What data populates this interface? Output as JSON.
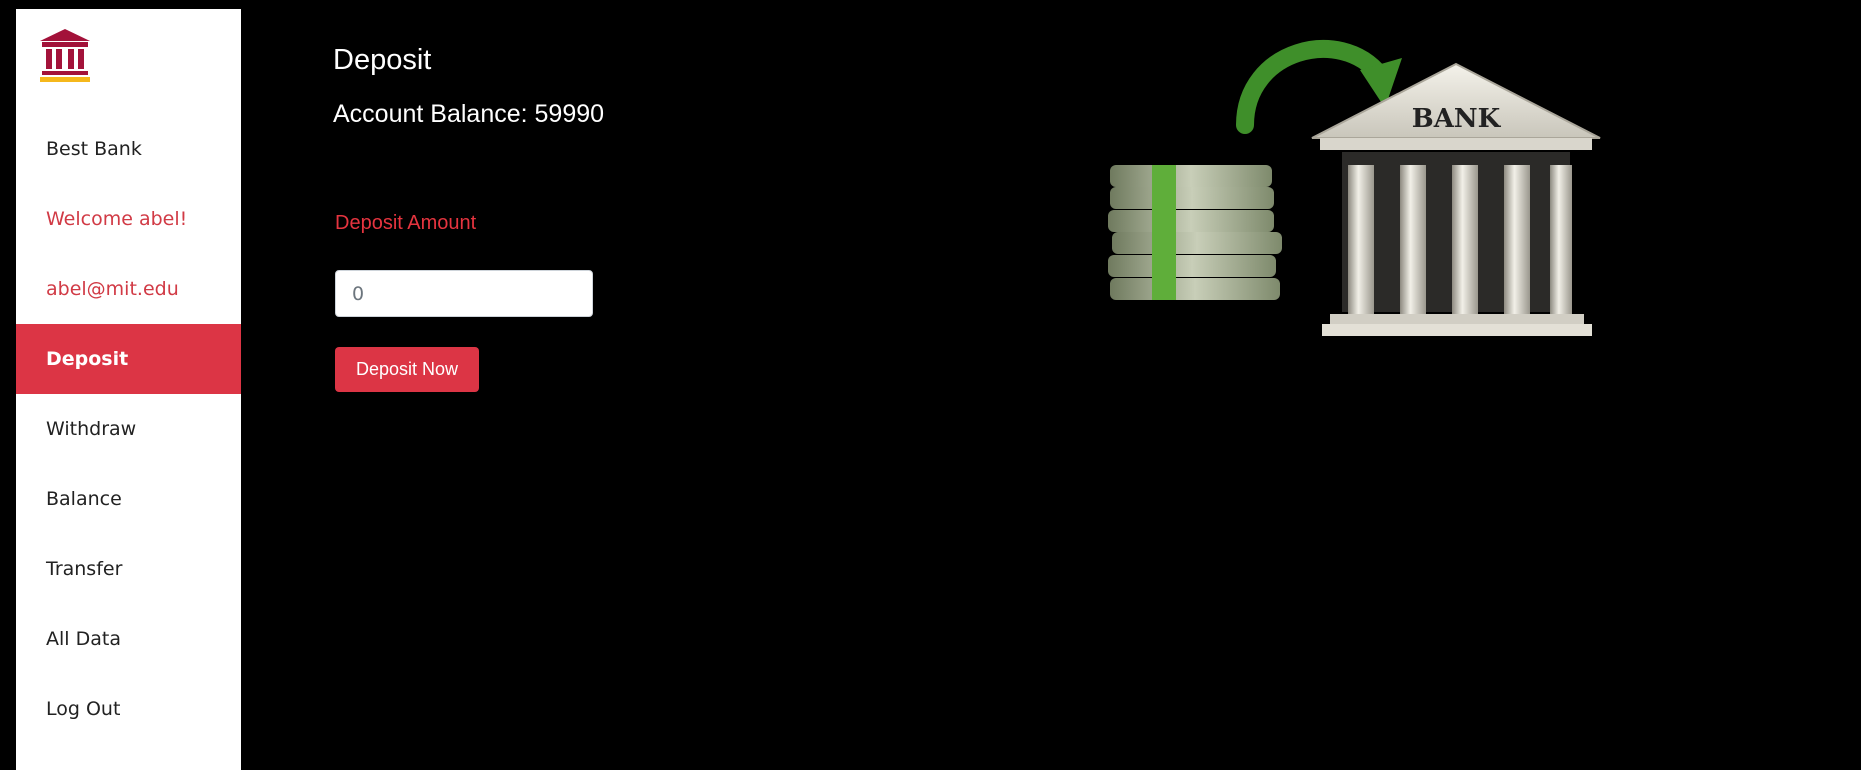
{
  "sidebar": {
    "logo_icon": "bank-icon",
    "items": [
      {
        "label": "Best Bank"
      },
      {
        "label": "Welcome abel!"
      },
      {
        "label": "abel@mit.edu"
      },
      {
        "label": "Deposit"
      },
      {
        "label": "Withdraw"
      },
      {
        "label": "Balance"
      },
      {
        "label": "Transfer"
      },
      {
        "label": "All Data"
      },
      {
        "label": "Log Out"
      }
    ],
    "active_item": "Deposit"
  },
  "main": {
    "title": "Deposit",
    "balance_text": "Account Balance: 59990",
    "amount_label": "Deposit Amount",
    "amount_placeholder": "0",
    "submit_label": "Deposit Now"
  },
  "illustration": {
    "building_text": "BANK"
  },
  "colors": {
    "accent": "#dc3545",
    "background": "#000000",
    "sidebar": "#ffffff"
  }
}
